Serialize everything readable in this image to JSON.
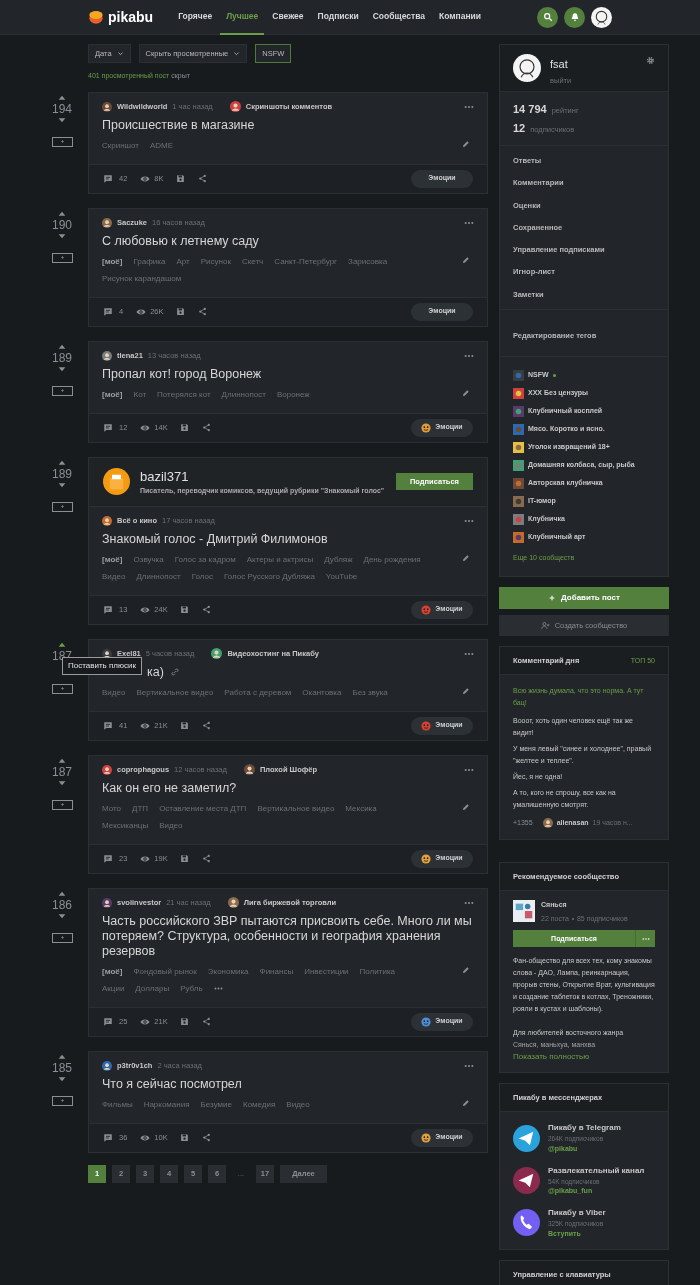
{
  "header": {
    "logo": "pikabu",
    "nav": [
      {
        "label": "Горячее",
        "selected": false
      },
      {
        "label": "Лучшее",
        "selected": true
      },
      {
        "label": "Свежее",
        "selected": false
      },
      {
        "label": "Подписки",
        "selected": false
      },
      {
        "label": "Сообщества",
        "selected": false
      },
      {
        "label": "Компании",
        "selected": false
      }
    ]
  },
  "filters": {
    "dropdowns": [
      "Дата",
      "Скрыть просмотренные"
    ],
    "nsfw": "NSFW",
    "hidden_count": "401 просмотренный пост",
    "hidden_suffix": "скрыт"
  },
  "posts": [
    {
      "rating": "194",
      "upvoted": false,
      "author": "Wildwildworld",
      "time": "1 час назад",
      "community": "Скриншоты комментов",
      "title": "Происшествие в магазине",
      "tags": [
        "Скриншот",
        "ADME"
      ],
      "comments": "42",
      "views": "8K",
      "emotions": "Эмоции"
    },
    {
      "rating": "190",
      "upvoted": false,
      "author": "Saczuke",
      "time": "16 часов назад",
      "title": "С любовью к летнему саду",
      "mine": "[моё]",
      "tags": [
        "Графика",
        "Арт",
        "Рисунок",
        "Скетч",
        "Санкт-Петербург",
        "Зарисовка",
        "Рисунок карандашом"
      ],
      "comments": "4",
      "views": "26K",
      "emotions": "Эмоции"
    },
    {
      "rating": "189",
      "upvoted": false,
      "author": "tlena21",
      "time": "13 часов назад",
      "title": "Пропал кот! город Воронеж",
      "mine": "[моё]",
      "tags": [
        "Кот",
        "Потерялся кот",
        "Длиннопост",
        "Воронеж"
      ],
      "comments": "12",
      "views": "14K",
      "emotions": "Эмоции",
      "emotion_icon": true
    },
    {
      "rating": "189",
      "upvoted": false,
      "author_header": {
        "name": "bazil371",
        "bio": "Писатель, переводчик комиксов, ведущий рубрики \"Знакомый голос\"",
        "button": "Подписаться"
      },
      "author": "Всё о кино",
      "time": "17 часов назад",
      "title": "Знакомый голос - Дмитрий Филимонов",
      "mine": "[моё]",
      "tags": [
        "Озвучка",
        "Голос за кадром",
        "Актеры и актрисы",
        "Дубляж",
        "День рождения",
        "Видео",
        "Длиннопост",
        "Голос",
        "Голос Русского Дубляжа",
        "YouTube"
      ],
      "comments": "13",
      "views": "24K",
      "emotions": "Эмоции",
      "emotion_icon": true
    },
    {
      "rating": "187",
      "upvoted": true,
      "tooltip": "Поставить плюсик",
      "author": "Exel81",
      "time": "5 часов назад",
      "community": "Видеохостинг на Пикабу",
      "title": "ка)",
      "link": true,
      "tags": [
        "Видео",
        "Вертикальное видео",
        "Работа с деревом",
        "Окантовка",
        "Без звука"
      ],
      "comments": "41",
      "views": "21K",
      "emotions": "Эмоции",
      "emotion_icon": true
    },
    {
      "rating": "187",
      "upvoted": false,
      "author": "coprophagous",
      "time": "12 часов назад",
      "community": "Плохой Шофёр",
      "title": "Как он его не заметил?",
      "tags": [
        "Мото",
        "ДТП",
        "Оставление места ДТП",
        "Вертикальное видео",
        "Мексика",
        "Мексиканцы",
        "Видео"
      ],
      "comments": "23",
      "views": "19K",
      "emotions": "Эмоции",
      "emotion_icon": true
    },
    {
      "rating": "186",
      "upvoted": false,
      "author": "svoiinvestor",
      "time": "21 час назад",
      "community": "Лига биржевой торговли",
      "title": "Часть российского ЗВР пытаются присвоить себе. Много ли мы потеряем? Структура, особенности и география хранения резервов",
      "mine": "[моё]",
      "tags": [
        "Фондовый рынок",
        "Экономика",
        "Финансы",
        "Инвестиции",
        "Политика",
        "Акции",
        "Доллары",
        "Рубль"
      ],
      "more_tags": true,
      "comments": "25",
      "views": "21K",
      "emotions": "Эмоции",
      "emotion_icon": true
    },
    {
      "rating": "185",
      "upvoted": false,
      "author": "p3tr0v1ch",
      "time": "2 часа назад",
      "title": "Что я сейчас посмотрел",
      "tags": [
        "Фильмы",
        "Наркомания",
        "Безумие",
        "Комедия",
        "Видео"
      ],
      "comments": "36",
      "views": "10K",
      "emotions": "Эмоции",
      "emotion_icon": true
    }
  ],
  "pagination": {
    "pages": [
      {
        "label": "1",
        "selected": true,
        "kind": "page"
      },
      {
        "label": "2",
        "selected": false,
        "kind": "page"
      },
      {
        "label": "3",
        "selected": false,
        "kind": "page"
      },
      {
        "label": "4",
        "selected": false,
        "kind": "page"
      },
      {
        "label": "5",
        "selected": false,
        "kind": "page"
      },
      {
        "label": "6",
        "selected": false,
        "kind": "page"
      },
      {
        "label": "...",
        "kind": "gap"
      },
      {
        "label": "17",
        "selected": false,
        "kind": "page"
      }
    ],
    "next": "Далее"
  },
  "sidebar": {
    "profile": {
      "name": "fsat",
      "logout": "выйти",
      "rating": "14 794",
      "rating_label": "рейтинг",
      "subscribers": "12",
      "subscribers_label": "подписчиков",
      "menu": [
        "Ответы",
        "Комментарии",
        "Оценки",
        "Сохраненное",
        "Управление подписками",
        "Игнор-лист",
        "Заметки"
      ],
      "edit_tags": "Редактирование тегов",
      "communities": [
        {
          "name": "NSFW",
          "online": true
        },
        {
          "name": "XXX Без цензуры",
          "online": false
        },
        {
          "name": "Клубничный косплей",
          "online": false
        },
        {
          "name": "Мясо. Коротко и ясно.",
          "online": false
        },
        {
          "name": "Уголок извращений 18+",
          "online": false
        },
        {
          "name": "Домашняя колбаса, сыр, рыба",
          "online": false
        },
        {
          "name": "Авторская клубничка",
          "online": false
        },
        {
          "name": "IT-юмор",
          "online": false
        },
        {
          "name": "Клубничка",
          "online": false
        },
        {
          "name": "Клубничный арт",
          "online": false
        }
      ],
      "more": "Еще 10 сообществ"
    },
    "add_post": "Добавить пост",
    "create_community": "Создать сообщество",
    "comment_of_day": {
      "title": "Комментарий дня",
      "top": "ТОП 50",
      "quote": "Всю жизнь думала, что это норма. А тут бац!",
      "lines": [
        "Вооот, хоть один человек ещё так же видит!",
        "У меня левый \"синее и холоднее\", правый \"желтее и теплее\".",
        "Йес, я не одна!",
        "А то, кого не спрошу, все как на умалишенную смотрят."
      ],
      "score": "+1355",
      "author": "alienasan",
      "time": "19 часов н..."
    },
    "recommended": {
      "title": "Рекомендуемое сообщество",
      "name": "Сянься",
      "posts": "22 поста",
      "subscribers": "85 подписчиков",
      "button": "Подписаться",
      "description": "Фан-общество для всех тех, кому знакомы слова - ДАО, Лампа, реинкарнация, прорыв стены, Открытие Врат, культивация и создание таблеток в котлах, Треножники, рояли в кустах и шаблоны).",
      "description_2": "Для любителей восточного жанра",
      "faded": "Сянься, маньхуа, манхва",
      "show_more": "Показать полностью"
    },
    "messengers": {
      "title": "Пикабу в мессенджерах",
      "items": [
        {
          "kind": "telegram",
          "name": "Пикабу в Telegram",
          "count": "264K подписчиков",
          "link": "@pikabu"
        },
        {
          "kind": "telegram_alt",
          "name": "Развлекательный канал",
          "count": "54K подписчиков",
          "link": "@pikabu_fun"
        },
        {
          "kind": "viber",
          "name": "Пикабу в Viber",
          "count": "325K подписчиков",
          "link": "Вступить"
        }
      ]
    },
    "keyboard": {
      "title": "Управление с клавиатуры"
    }
  }
}
